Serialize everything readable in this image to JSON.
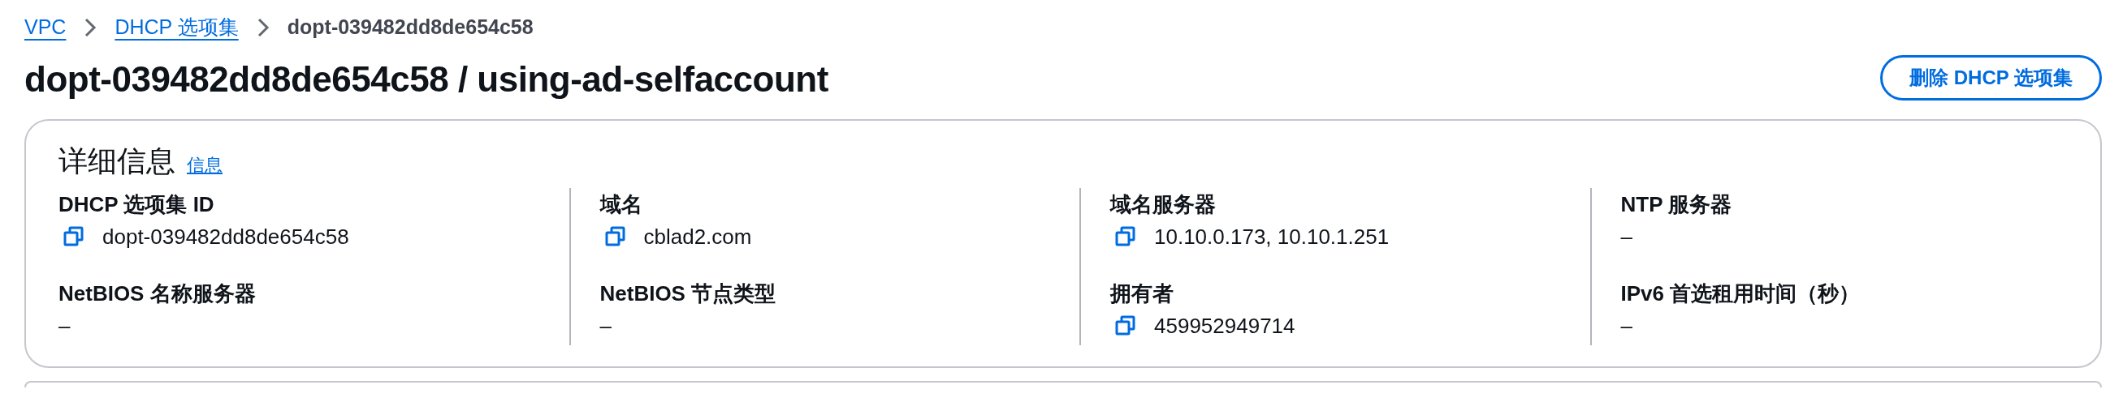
{
  "breadcrumb": [
    {
      "label": "VPC",
      "kind": "link"
    },
    {
      "label": "DHCP 选项集",
      "kind": "link"
    },
    {
      "label": "dopt-039482dd8de654c58",
      "kind": "current"
    }
  ],
  "page_title": "dopt-039482dd8de654c58 / using-ad-selfaccount",
  "actions": [
    "删除 DHCP 选项集"
  ],
  "details": {
    "title": "详细信息",
    "info_link": "信息",
    "columns": [
      {
        "fields": [
          {
            "label": "DHCP 选项集 ID",
            "value": "dopt-039482dd8de654c58",
            "copyable": true
          },
          {
            "label": "NetBIOS 名称服务器",
            "value": "–",
            "copyable": false
          }
        ]
      },
      {
        "fields": [
          {
            "label": "域名",
            "value": "cblad2.com",
            "copyable": true
          },
          {
            "label": "NetBIOS 节点类型",
            "value": "–",
            "copyable": false
          }
        ]
      },
      {
        "fields": [
          {
            "label": "域名服务器",
            "value": "10.10.0.173, 10.10.1.251",
            "copyable": true
          },
          {
            "label": "拥有者",
            "value": "459952949714",
            "copyable": true
          }
        ]
      },
      {
        "fields": [
          {
            "label": "NTP 服务器",
            "value": "–",
            "copyable": false
          },
          {
            "label": "IPv6 首选租用时间（秒）",
            "value": "–",
            "copyable": false
          }
        ]
      }
    ]
  }
}
